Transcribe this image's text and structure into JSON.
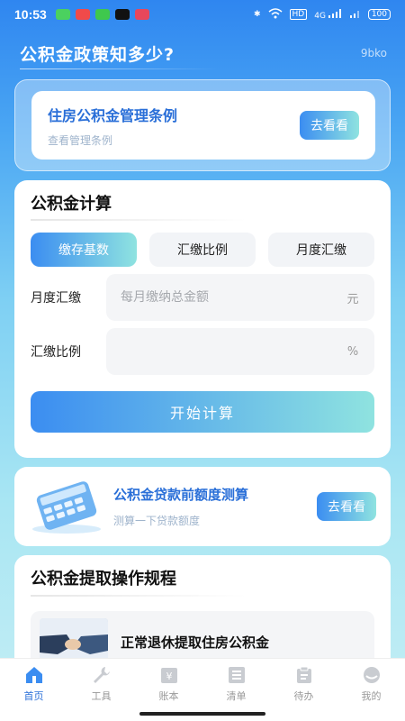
{
  "status_bar": {
    "time": "10:53",
    "network": "4G",
    "battery": "100",
    "hd_label": "HD"
  },
  "header": {
    "title": "公积金政策知多少?",
    "tag": "9bko"
  },
  "regulation": {
    "title": "住房公积金管理条例",
    "subtitle": "查看管理条例",
    "button": "去看看"
  },
  "calculator": {
    "title": "公积金计算",
    "tabs": [
      {
        "label": "缴存基数",
        "active": true
      },
      {
        "label": "汇缴比例",
        "active": false
      },
      {
        "label": "月度汇缴",
        "active": false
      }
    ],
    "fields": [
      {
        "label": "月度汇缴",
        "placeholder": "每月缴纳总金额",
        "unit": "元"
      },
      {
        "label": "汇缴比例",
        "placeholder": "",
        "unit": "%"
      }
    ],
    "submit": "开始计算"
  },
  "loan": {
    "title": "公积金贷款前额度测算",
    "subtitle": "测算一下贷款额度",
    "button": "去看看"
  },
  "rules": {
    "title": "公积金提取操作规程",
    "items": [
      {
        "title": "正常退休提取住房公积金"
      }
    ]
  },
  "tabbar": [
    {
      "label": "首页",
      "icon": "home-icon",
      "active": true
    },
    {
      "label": "工具",
      "icon": "wrench-icon",
      "active": false
    },
    {
      "label": "账本",
      "icon": "ledger-icon",
      "active": false
    },
    {
      "label": "清单",
      "icon": "list-icon",
      "active": false
    },
    {
      "label": "待办",
      "icon": "todo-icon",
      "active": false
    },
    {
      "label": "我的",
      "icon": "profile-icon",
      "active": false
    }
  ],
  "colors": {
    "accent": "#2a6fd8",
    "gradient_start": "#3b8df1",
    "gradient_end": "#8fe3e0"
  }
}
